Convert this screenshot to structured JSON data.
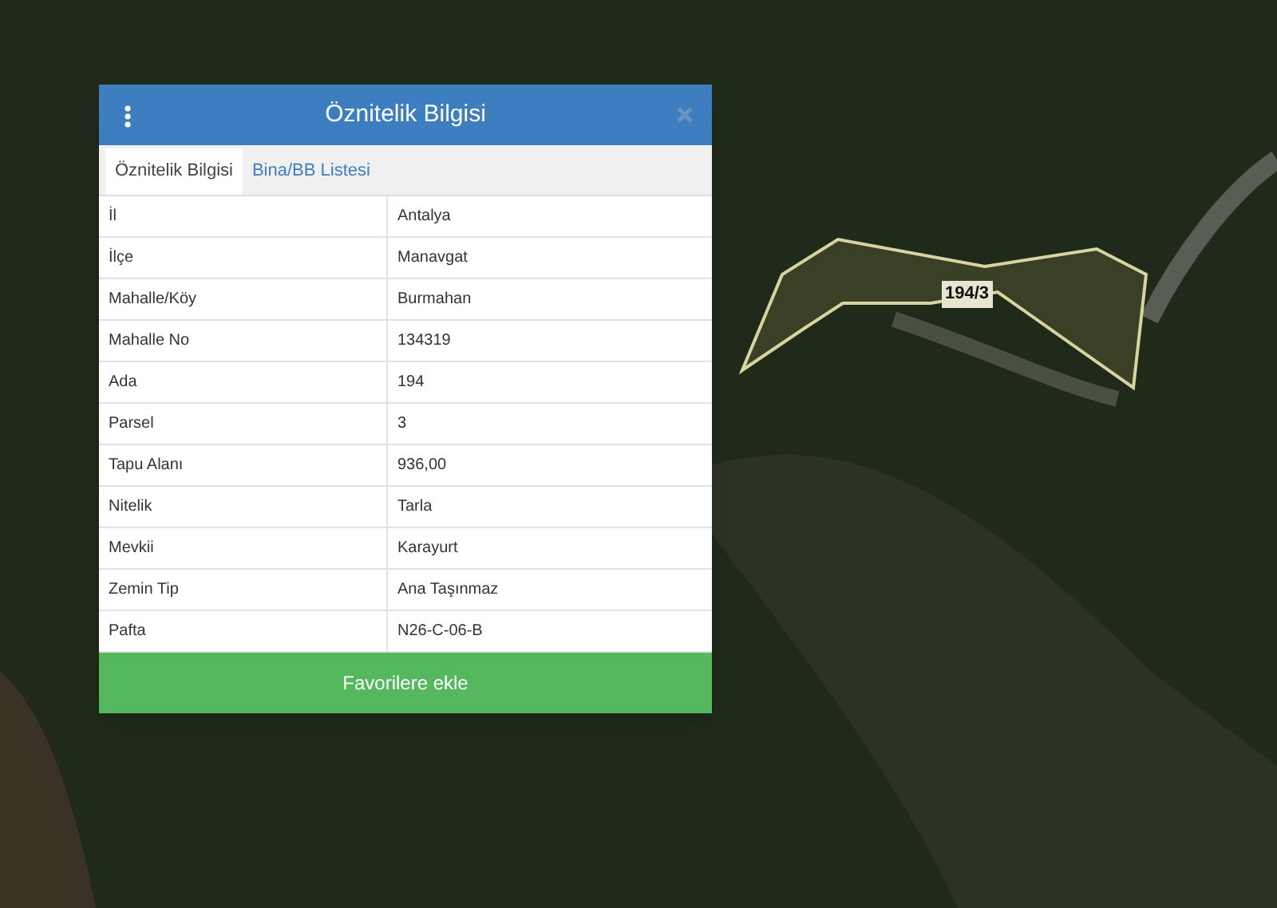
{
  "map": {
    "parcel_label": "194/3"
  },
  "dialog": {
    "title": "Öznitelik Bilgisi",
    "tabs": [
      {
        "label": "Öznitelik Bilgisi",
        "selected": true
      },
      {
        "label": "Bina/BB Listesi",
        "selected": false
      }
    ],
    "rows": [
      {
        "label": "İl",
        "value": "Antalya"
      },
      {
        "label": "İlçe",
        "value": "Manavgat"
      },
      {
        "label": "Mahalle/Köy",
        "value": "Burmahan"
      },
      {
        "label": "Mahalle No",
        "value": "134319"
      },
      {
        "label": "Ada",
        "value": "194"
      },
      {
        "label": "Parsel",
        "value": "3"
      },
      {
        "label": "Tapu Alanı",
        "value": "936,00"
      },
      {
        "label": "Nitelik",
        "value": "Tarla"
      },
      {
        "label": "Mevkii",
        "value": "Karayurt"
      },
      {
        "label": "Zemin Tip",
        "value": "Ana Taşınmaz"
      },
      {
        "label": "Pafta",
        "value": "N26-C-06-B"
      }
    ],
    "button": "Favorilere ekle"
  }
}
